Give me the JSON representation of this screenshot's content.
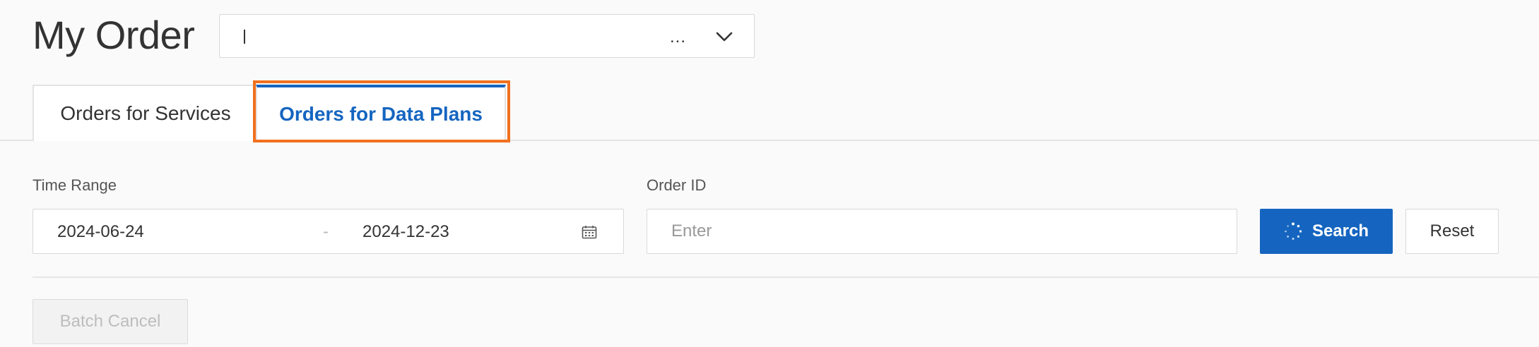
{
  "header": {
    "title": "My Order",
    "selector_value": "...",
    "selector_icon": "chevron-down-icon"
  },
  "tabs": [
    {
      "label": "Orders for Services",
      "active": false
    },
    {
      "label": "Orders for Data Plans",
      "active": true
    }
  ],
  "filters": {
    "time_range_label": "Time Range",
    "start_date": "2024-06-24",
    "separator": "-",
    "end_date": "2024-12-23",
    "calendar_icon": "calendar-icon",
    "order_id_label": "Order ID",
    "order_id_placeholder": "Enter",
    "order_id_value": ""
  },
  "actions": {
    "search_label": "Search",
    "search_icon": "loading-spinner-icon",
    "reset_label": "Reset",
    "batch_cancel_label": "Batch Cancel"
  },
  "colors": {
    "accent": "#1565c0",
    "highlight": "#f2701e",
    "background": "#fafafa"
  }
}
